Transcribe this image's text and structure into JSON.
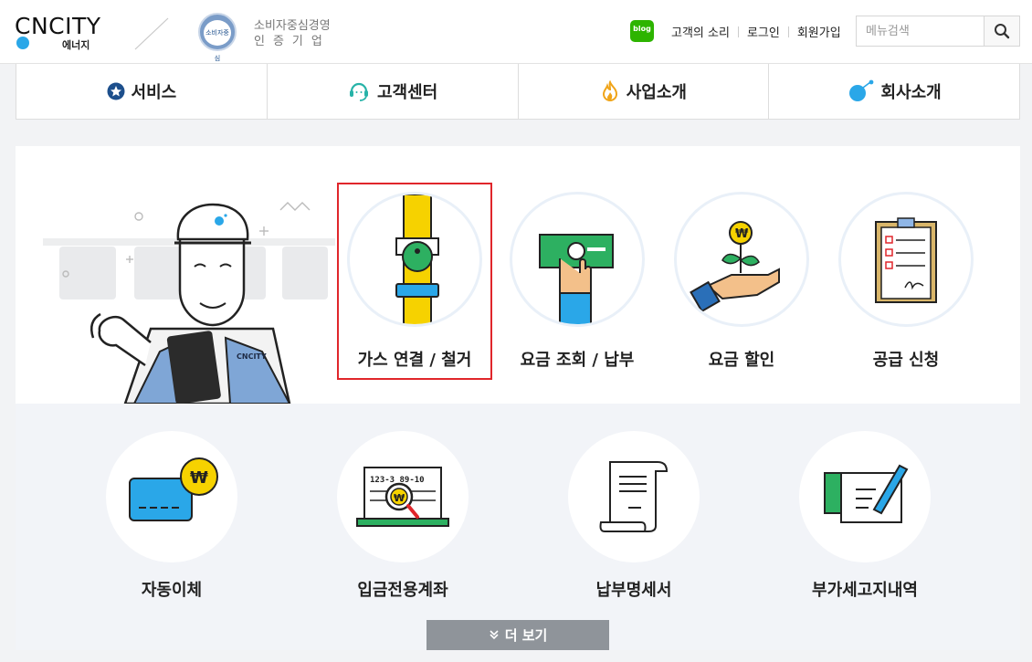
{
  "header": {
    "logo_text": "CNCITY",
    "logo_sub": "에너지",
    "cert_badge_text": "소비자중심",
    "cert_line1": "소비자중심경영",
    "cert_line2": "인증기업",
    "blog_label": "blog",
    "links": [
      "고객의 소리",
      "로그인",
      "회원가입"
    ],
    "search_placeholder": "메뉴검색"
  },
  "nav": {
    "items": [
      {
        "label": "서비스",
        "icon": "star-badge-icon"
      },
      {
        "label": "고객센터",
        "icon": "headset-icon"
      },
      {
        "label": "사업소개",
        "icon": "flame-icon"
      },
      {
        "label": "회사소개",
        "icon": "dot-circle-icon"
      }
    ]
  },
  "services_primary": [
    {
      "label": "가스 연결 / 철거",
      "icon": "gas-pipe-icon",
      "selected": true
    },
    {
      "label": "요금 조회 / 납부",
      "icon": "cash-hand-icon",
      "selected": false
    },
    {
      "label": "요금 할인",
      "icon": "coin-plant-icon",
      "selected": false
    },
    {
      "label": "공급 신청",
      "icon": "clipboard-icon",
      "selected": false
    }
  ],
  "services_secondary": [
    {
      "label": "자동이체",
      "icon": "card-won-icon"
    },
    {
      "label": "입금전용계좌",
      "icon": "account-search-icon",
      "account_text": "123-3 89-10"
    },
    {
      "label": "납부명세서",
      "icon": "receipt-icon"
    },
    {
      "label": "부가세고지내역",
      "icon": "tax-document-icon"
    }
  ],
  "illustration": {
    "shirt_logo": "CNCITY"
  },
  "more_button_label": "더 보기",
  "colors": {
    "accent_blue": "#2aa7e8",
    "selected_border": "#e0262b",
    "more_button": "#8f949a",
    "blog_green": "#2db400"
  }
}
